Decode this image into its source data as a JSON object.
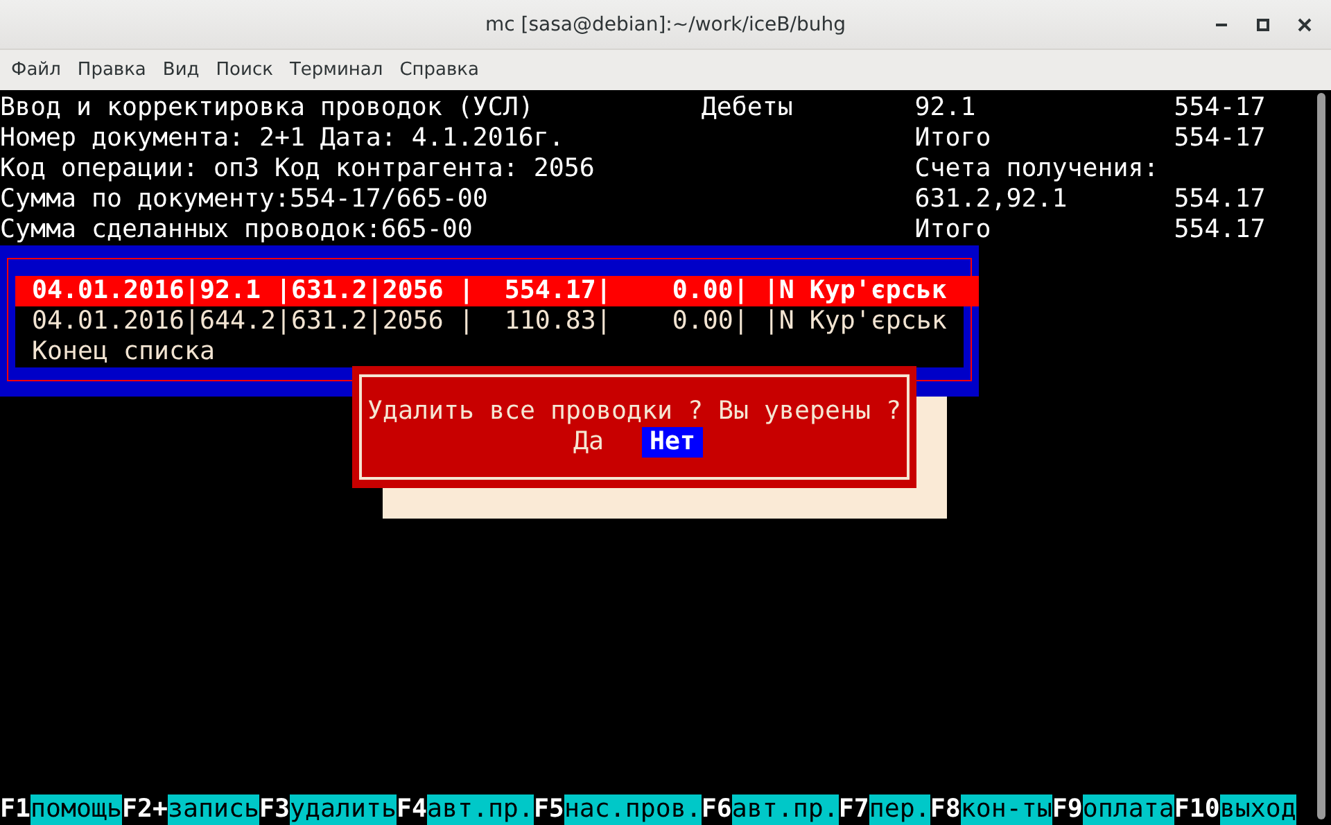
{
  "window": {
    "title": "mc [sasa@debian]:~/work/iceB/buhg"
  },
  "menu": [
    "Файл",
    "Правка",
    "Вид",
    "Поиск",
    "Терминал",
    "Справка"
  ],
  "header": {
    "lines": [
      "Ввод и корректировка проводок (УСЛ)",
      "Номер документа: 2+1 Дата: 4.1.2016г.",
      "Код операции: оп3 Код контрагента: 2056",
      "Сумма по документу:554-17/665-00",
      "Сумма сделанных проводок:665-00"
    ],
    "summary": [
      {
        "label": "Дебеты",
        "account": "92.1",
        "amount": "554-17"
      },
      {
        "account": "Итого",
        "amount": "554-17"
      },
      {
        "account": "Счета получения:"
      },
      {
        "account": "631.2,92.1",
        "amount": "554.17"
      },
      {
        "account": "Итого",
        "amount": "554.17"
      }
    ]
  },
  "entries": [
    {
      "text": "04.01.2016|92.1 |631.2|2056 |  554.17|    0.00| |N Кур'єрськ",
      "selected": true
    },
    {
      "text": "04.01.2016|644.2|631.2|2056 |  110.83|    0.00| |N Кур'єрськ",
      "selected": false
    }
  ],
  "list_end": "Конец списка",
  "dialog": {
    "message": "Удалить все проводки ? Вы уверены ?",
    "buttons": [
      {
        "label": "Да",
        "selected": false
      },
      {
        "label": "Нет",
        "selected": true
      }
    ]
  },
  "function_keys": [
    {
      "key": "F1",
      "label": "помощь"
    },
    {
      "key": "F2+",
      "label": "запись"
    },
    {
      "key": "F3",
      "label": "удалить"
    },
    {
      "key": "F4",
      "label": "авт.пр."
    },
    {
      "key": "F5",
      "label": "нас.пров."
    },
    {
      "key": "F6",
      "label": "авт.пр."
    },
    {
      "key": "F7",
      "label": "пер."
    },
    {
      "key": "F8",
      "label": "кон-ты"
    },
    {
      "key": "F9",
      "label": "оплата"
    },
    {
      "key": "F10",
      "label": "выход"
    }
  ]
}
